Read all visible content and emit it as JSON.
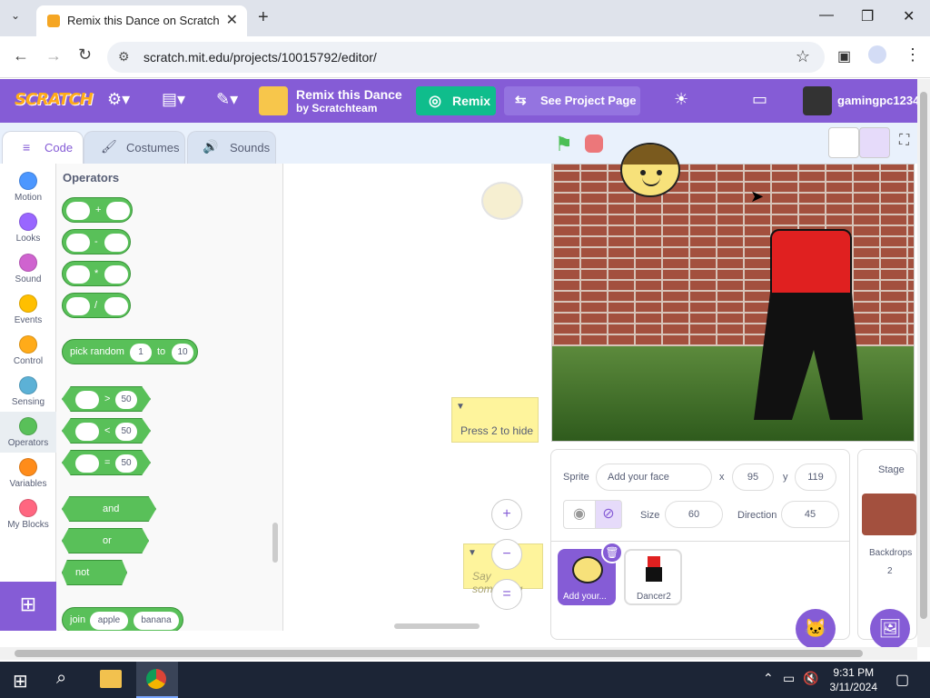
{
  "browser": {
    "tab_title": "Remix this Dance on Scratch",
    "tab_close": "✕",
    "new_tab": "+",
    "url": "scratch.mit.edu/projects/10015792/editor/",
    "window_min": "—",
    "window_max": "❐",
    "window_close": "✕"
  },
  "menubar": {
    "logo": "SCRATCH",
    "project_title": "Remix this Dance",
    "project_author": "by Scratchteam",
    "remix_label": "Remix",
    "see_project_label": "See Project Page",
    "username": "gamingpc1234"
  },
  "editor_tabs": [
    {
      "label": "Code",
      "active": true
    },
    {
      "label": "Costumes",
      "active": false
    },
    {
      "label": "Sounds",
      "active": false
    }
  ],
  "categories": [
    {
      "label": "Motion",
      "color": "#4c97ff"
    },
    {
      "label": "Looks",
      "color": "#9966ff"
    },
    {
      "label": "Sound",
      "color": "#cf63cf"
    },
    {
      "label": "Events",
      "color": "#ffbf00"
    },
    {
      "label": "Control",
      "color": "#ffab19"
    },
    {
      "label": "Sensing",
      "color": "#5cb1d6"
    },
    {
      "label": "Operators",
      "color": "#59c059"
    },
    {
      "label": "Variables",
      "color": "#ff8c1a"
    },
    {
      "label": "My Blocks",
      "color": "#ff6680"
    }
  ],
  "palette": {
    "title": "Operators",
    "arith_ops": [
      "+",
      "-",
      "*",
      "/"
    ],
    "pick_random": {
      "label": "pick random",
      "from": "1",
      "to_label": "to",
      "to": "10"
    },
    "compare": [
      {
        "op": ">",
        "value": "50"
      },
      {
        "op": "<",
        "value": "50"
      },
      {
        "op": "=",
        "value": "50"
      }
    ],
    "and_label": "and",
    "or_label": "or",
    "not_label": "not",
    "join": {
      "label": "join",
      "a": "apple",
      "b": "banana"
    }
  },
  "script_area": {
    "comment1": "Press 2 to hide",
    "comment2": "Say something",
    "zoom_in": "+",
    "zoom_out": "−",
    "zoom_reset": "="
  },
  "sprite_info": {
    "sprite_label": "Sprite",
    "sprite_name": "Add your face",
    "x_label": "x",
    "x": "95",
    "y_label": "y",
    "y": "119",
    "size_label": "Size",
    "size": "60",
    "direction_label": "Direction",
    "direction": "45",
    "sprites": [
      {
        "name": "Add your...",
        "selected": true
      },
      {
        "name": "Dancer2",
        "selected": false
      }
    ]
  },
  "stage_panel": {
    "title": "Stage",
    "backdrops_label": "Backdrops",
    "backdrops_count": "2"
  },
  "taskbar": {
    "time": "9:31 PM",
    "date": "3/11/2024"
  }
}
